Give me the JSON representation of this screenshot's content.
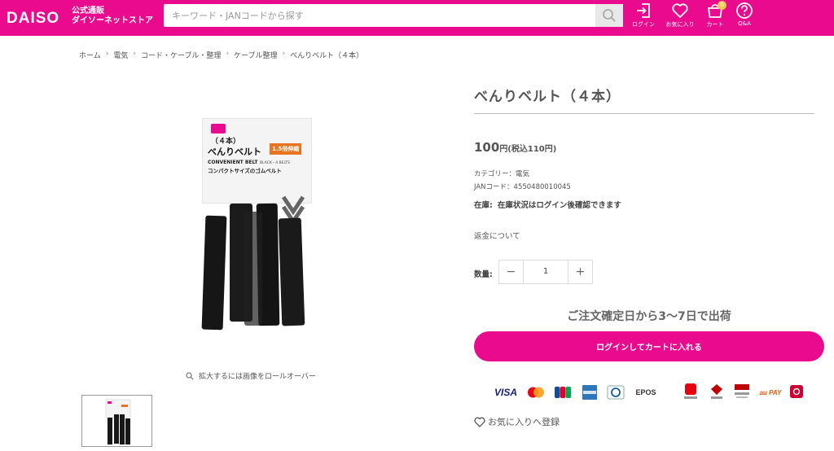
{
  "header": {
    "logo": "DAISO",
    "logo_sub_line1": "公式通販",
    "logo_sub_line2": "ダイソーネットストア",
    "search_placeholder": "キーワード・JANコードから探す",
    "nav": [
      {
        "label": "ログイン",
        "icon": "login-icon"
      },
      {
        "label": "お気に入り",
        "icon": "heart-icon"
      },
      {
        "label": "カート",
        "icon": "cart-icon",
        "badge": "0"
      },
      {
        "label": "Q&A",
        "icon": "question-icon"
      }
    ],
    "brand_color": "#ea0a8e"
  },
  "breadcrumb": [
    "ホーム",
    "電気",
    "コード・ケーブル・整理",
    "ケーブル整理",
    "べんりベルト（４本）"
  ],
  "gallery": {
    "zoom_hint": "拡大するには画像をロールオーバー",
    "package_text_top": "（４本）",
    "package_text_main": "べんりベルト",
    "package_badge": "1.5倍伸縮",
    "package_english": "CONVENIENT BELT",
    "package_english_sub": "BLACK・4 BELTS",
    "package_caption": "コンパクトサイズのゴムベルト"
  },
  "product": {
    "title": "べんりベルト（４本）",
    "price_number": "100",
    "price_unit": "円(税込110円)",
    "category": "カテゴリー：電気",
    "jan": "JANコード：4550480010045",
    "stock_label": "在庫:",
    "stock_value": "在庫状況はログイン後確認できます",
    "refund_link": "返金について",
    "qty_label": "数量:",
    "qty_value": "1",
    "qty_minus": "−",
    "qty_plus": "+",
    "ship_note": "ご注文確定日から3〜7日で出荷",
    "cta": "ログインしてカートに入れる",
    "favorite": "お気に入りへ登録"
  },
  "payments": [
    {
      "name": "VISA",
      "color": "#1a1f71"
    },
    {
      "name": "Mastercard",
      "color": "#eb001b"
    },
    {
      "name": "JCB",
      "color": "#0b4ea2"
    },
    {
      "name": "AMERICAN EXPRESS",
      "color": "#2e77bb"
    },
    {
      "name": "Diners Club",
      "color": "#004a97"
    },
    {
      "name": "EPOS",
      "color": "#d71920"
    },
    {
      "name": "PayPay",
      "color": "#e60012"
    },
    {
      "name": "楽天Pay",
      "color": "#bf0000"
    },
    {
      "name": "R Pay",
      "color": "#bf0000"
    },
    {
      "name": "au PAY",
      "color": "#eb5505"
    },
    {
      "name": "d払い",
      "color": "#cc0033"
    }
  ]
}
